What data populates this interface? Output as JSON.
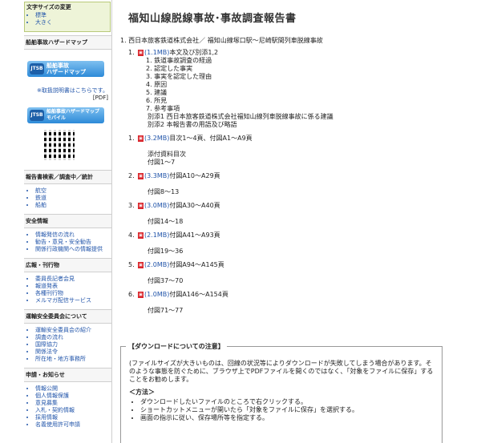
{
  "sidebar": {
    "font_size": {
      "title": "文字サイズの変更",
      "options": [
        "標準",
        "大きく"
      ]
    },
    "hazard_map_title": "船舶事故ハザードマップ",
    "banner1": {
      "logo": "JTSB",
      "label": "船舶事故\nハザードマップ"
    },
    "manual_link": "※取扱説明書はこちらです。",
    "pdf_note": "[PDF]",
    "banner2": {
      "logo": "JTSB",
      "label": "船舶事故ハザードマップ\nモバイル"
    },
    "sections": [
      {
        "title": "報告書検索／調査中／統計",
        "items": [
          "航空",
          "鉄道",
          "船舶"
        ]
      },
      {
        "title": "安全情報",
        "items": [
          "情報発信の流れ",
          "勧告・意見・安全勧告",
          "関係行政機関への情報提供"
        ]
      },
      {
        "title": "広報・刊行物",
        "items": [
          "委員長記者会見",
          "報道発表",
          "各種刊行物",
          "メルマガ配信サービス"
        ]
      },
      {
        "title": "運輸安全委員会について",
        "items": [
          "運輸安全委員会の紹介",
          "調査の流れ",
          "国際協力",
          "関係法令",
          "所在地・地方事務所"
        ]
      },
      {
        "title": "申請・お知らせ",
        "items": [
          "情報公開",
          "個人情報保護",
          "意見募集",
          "入札・契約情報",
          "採用情報",
          "名義使用許可申請"
        ]
      }
    ]
  },
  "main": {
    "title": "福知山線脱線事故･事故調査報告書",
    "report_head": "1.  西日本旅客鉄道株式会社／ 福知山線塚口駅～尼崎駅間列車脱線事故",
    "documents": [
      {
        "num": "1.",
        "size": "(1.1MB)",
        "text": "本文及び別添1,2",
        "sub": [
          "1.  鉄道事故調査の経過",
          "2.  認定した事実",
          "3.  事実を認定した理由",
          "4.  原因",
          "5.  建議",
          "6.  所見",
          "7.  参考事項"
        ],
        "extra": [
          "別添1 西日本旅客鉄道株式会社福知山線列車脱線事故に係る建議",
          "別添2 本報告書の用語及び略語"
        ]
      },
      {
        "num": "1.",
        "size": "(3.2MB)",
        "text": "目次1～4頁、付図A1～A9頁",
        "extra": [
          "",
          "添付資料目次",
          "付図1～7"
        ]
      },
      {
        "num": "2.",
        "size": "(3.3MB)",
        "text": "付図A10～A29頁",
        "extra": [
          "",
          "付図8～13"
        ]
      },
      {
        "num": "3.",
        "size": "(3.0MB)",
        "text": "付図A30～A40頁",
        "extra": [
          "",
          "付図14～18"
        ]
      },
      {
        "num": "4.",
        "size": "(2.1MB)",
        "text": "付図A41～A93頁",
        "extra": [
          "",
          "付図19～36"
        ]
      },
      {
        "num": "5.",
        "size": "(2.0MB)",
        "text": "付図A94～A145頁",
        "extra": [
          "",
          "付図37～70"
        ]
      },
      {
        "num": "6.",
        "size": "(1.0MB)",
        "text": "付図A146～A154頁",
        "extra": [
          "",
          "付図71～77"
        ]
      }
    ],
    "download": {
      "title": "【ダウンロードについての注意】",
      "para1": "(ファイルサイズが大きいものは、回線の状況等によりダウンロードが失敗してしまう場合があります。そのような事態を防ぐために、ブラウザ上でPDFファイルを開くのではなく、「対象をファイルに保存」することをお勧めします。",
      "method_title": "＜方法＞",
      "steps": [
        "ダウンロードしたいファイルのところで右クリックする。",
        "ショートカットメニューが開いたら「対象をファイルに保存」を選択する。",
        "画面の指示に従い、保存場所等を指定する。"
      ]
    }
  }
}
